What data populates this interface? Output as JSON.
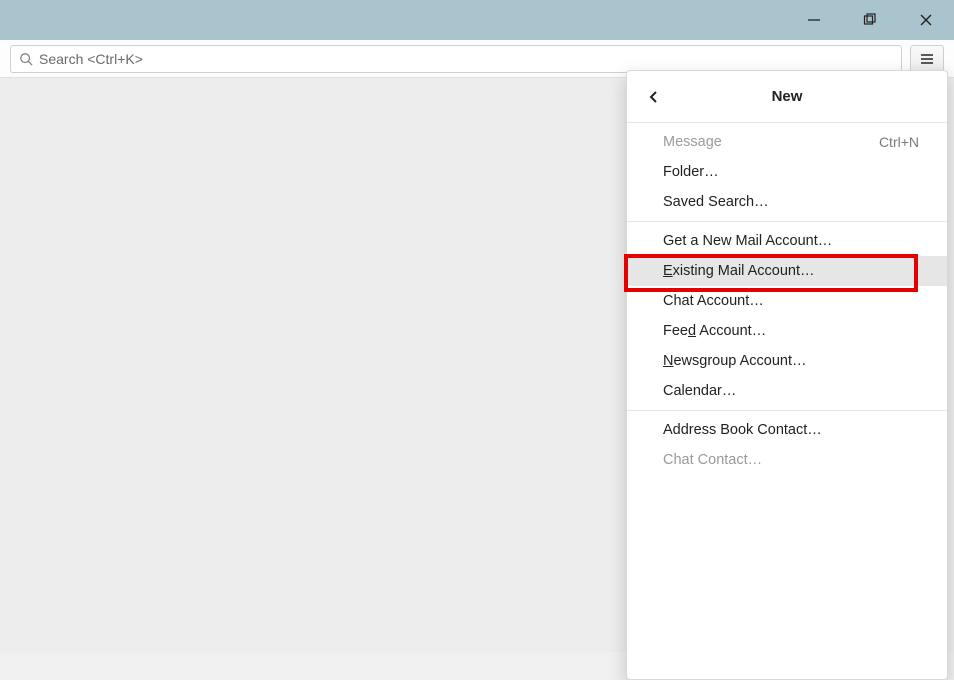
{
  "titlebar": {},
  "toolbar": {
    "search_placeholder": "Search <Ctrl+K>"
  },
  "menu": {
    "title": "New",
    "section1": {
      "message": {
        "label": "Message",
        "shortcut": "Ctrl+N",
        "disabled": true
      },
      "folder": {
        "label": "Folder…"
      },
      "savedSearch": {
        "label": "Saved Search…"
      }
    },
    "section2": {
      "getNewMail": {
        "label": "Get a New Mail Account…"
      },
      "existingMail": {
        "label_pre": "",
        "label_u": "E",
        "label_post": "xisting Mail Account…"
      },
      "chatAccount": {
        "label": "Chat Account…"
      },
      "feedAccount": {
        "label_pre": "Fee",
        "label_u": "d",
        "label_post": " Account…"
      },
      "newsgroup": {
        "label_pre": "",
        "label_u": "N",
        "label_post": "ewsgroup Account…"
      },
      "calendar": {
        "label": "Calendar…"
      }
    },
    "section3": {
      "addressBook": {
        "label": "Address Book Contact…"
      },
      "chatContact": {
        "label": "Chat Contact…",
        "disabled": true
      }
    }
  }
}
